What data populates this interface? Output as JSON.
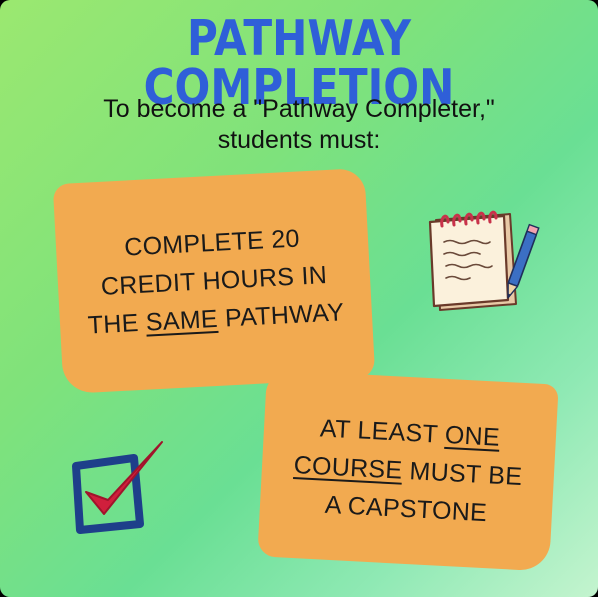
{
  "poster": {
    "title": "PATHWAY COMPLETION",
    "subtitle_line1": "To become a \"Pathway Completer,\"",
    "subtitle_line2": "students must:",
    "card1": {
      "line1": "COMPLETE 20",
      "line2": "CREDIT HOURS IN",
      "line3_pre": "THE ",
      "line3_underlined": "SAME",
      "line3_post": " PATHWAY"
    },
    "card2": {
      "line1_pre": "AT LEAST ",
      "line1_underlined": "ONE",
      "line2_underlined": "COURSE",
      "line2_post": " MUST BE",
      "line3": "A CAPSTONE"
    },
    "icons": {
      "notepad": "notepad-with-pencil-icon",
      "checkbox": "checked-box-icon"
    },
    "colors": {
      "title": "#2f5fd8",
      "card": "#f2aa50",
      "check": "#d01f3c",
      "box": "#1e3f8a"
    }
  }
}
